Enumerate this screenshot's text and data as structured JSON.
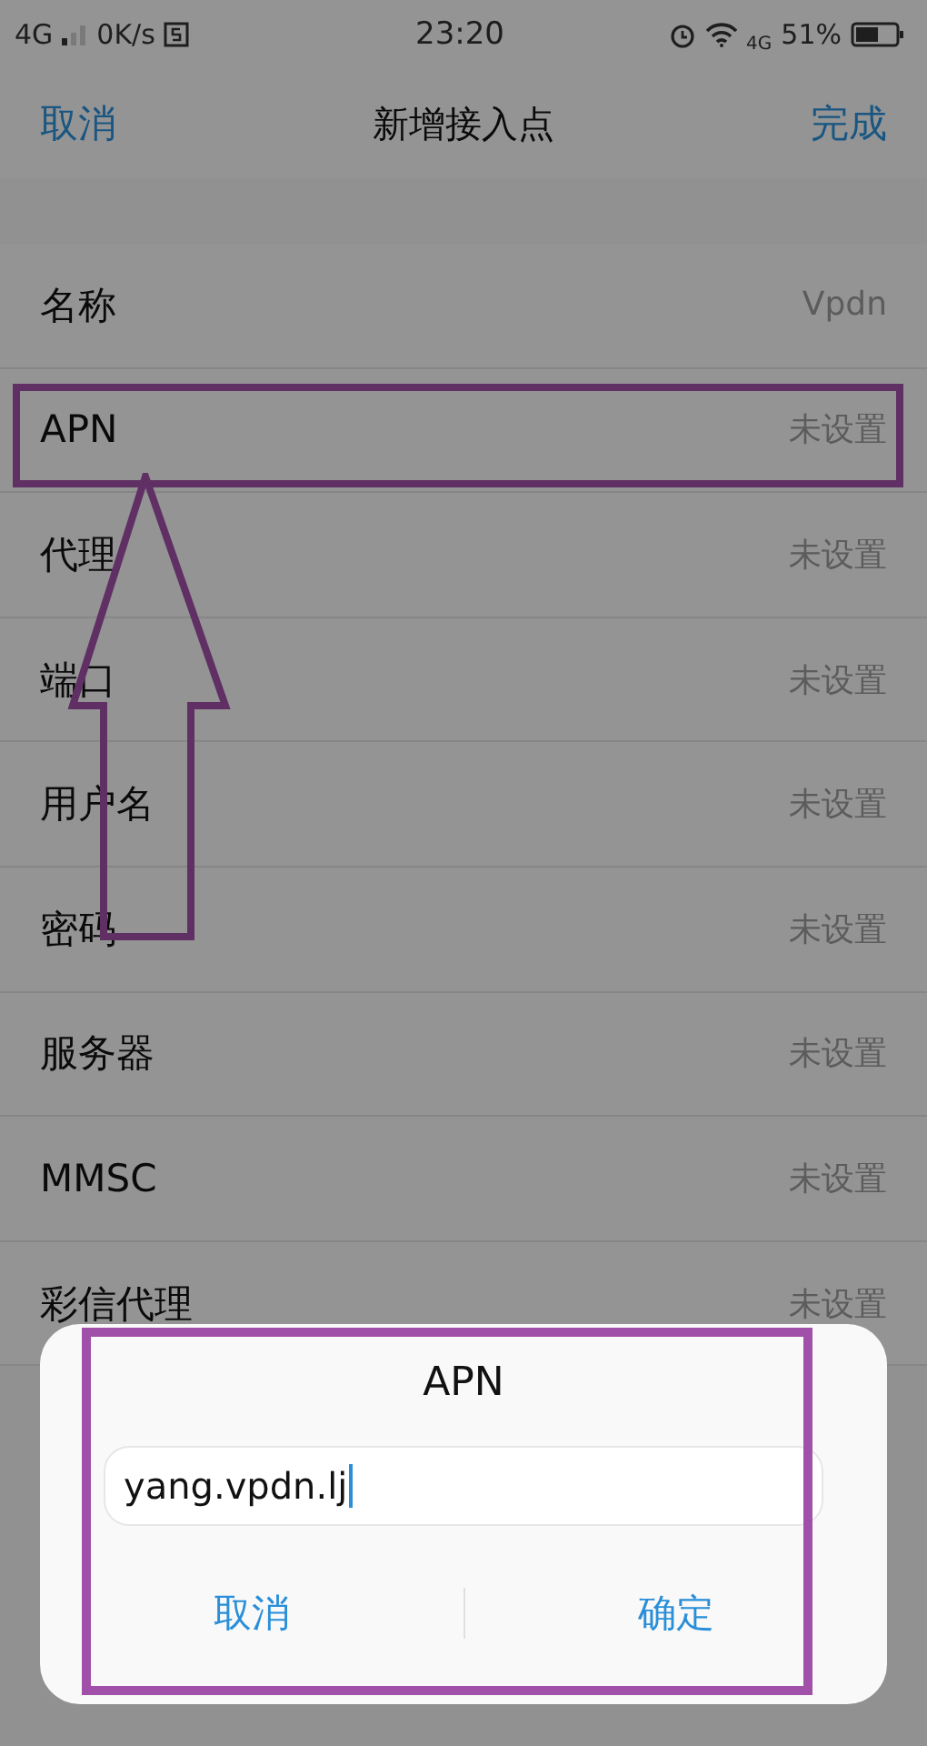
{
  "status_bar": {
    "network": "4G",
    "speed": "0K/s",
    "time": "23:20",
    "data_type": "4G",
    "battery": "51%"
  },
  "nav": {
    "cancel": "取消",
    "title": "新增接入点",
    "done": "完成"
  },
  "fields": [
    {
      "label": "名称",
      "value": "Vpdn",
      "highlighted": false
    },
    {
      "label": "APN",
      "value": "未设置",
      "highlighted": true
    },
    {
      "label": "代理",
      "value": "未设置",
      "highlighted": false
    },
    {
      "label": "端口",
      "value": "未设置",
      "highlighted": false
    },
    {
      "label": "用户名",
      "value": "未设置",
      "highlighted": false
    },
    {
      "label": "密码",
      "value": "未设置",
      "highlighted": false
    },
    {
      "label": "服务器",
      "value": "未设置",
      "highlighted": false
    },
    {
      "label": "MMSC",
      "value": "未设置",
      "highlighted": false
    },
    {
      "label": "彩信代理",
      "value": "未设置",
      "highlighted": false
    }
  ],
  "pointer_arrow": true,
  "dialog": {
    "title": "APN",
    "value": "yang.vpdn.lj",
    "buttons": [
      "取消",
      "确定"
    ],
    "highlighted": true
  }
}
